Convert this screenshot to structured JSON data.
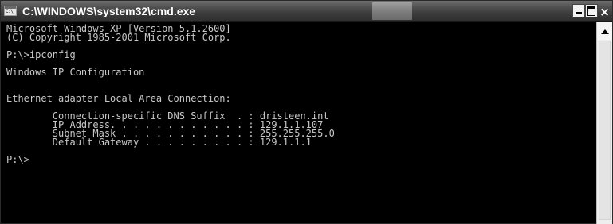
{
  "window": {
    "title": "C:\\WINDOWS\\system32\\cmd.exe",
    "icon_prompt": "C:\\",
    "controls": {
      "minimize": "minimize",
      "maximize": "maximize",
      "close_label": "×"
    }
  },
  "console": {
    "lines": [
      "Microsoft Windows XP [Version 5.1.2600]",
      "(C) Copyright 1985-2001 Microsoft Corp.",
      "",
      "P:\\>ipconfig",
      "",
      "Windows IP Configuration",
      "",
      "",
      "Ethernet adapter Local Area Connection:",
      "",
      "        Connection-specific DNS Suffix  . : dristeen.int",
      "        IP Address. . . . . . . . . . . . : 129.1.1.107",
      "        Subnet Mask . . . . . . . . . . . : 255.255.255.0",
      "        Default Gateway . . . . . . . . . : 129.1.1.1",
      "",
      "P:\\>"
    ]
  },
  "scrollbar": {
    "up_arrow": "scroll-up-arrow-icon"
  }
}
